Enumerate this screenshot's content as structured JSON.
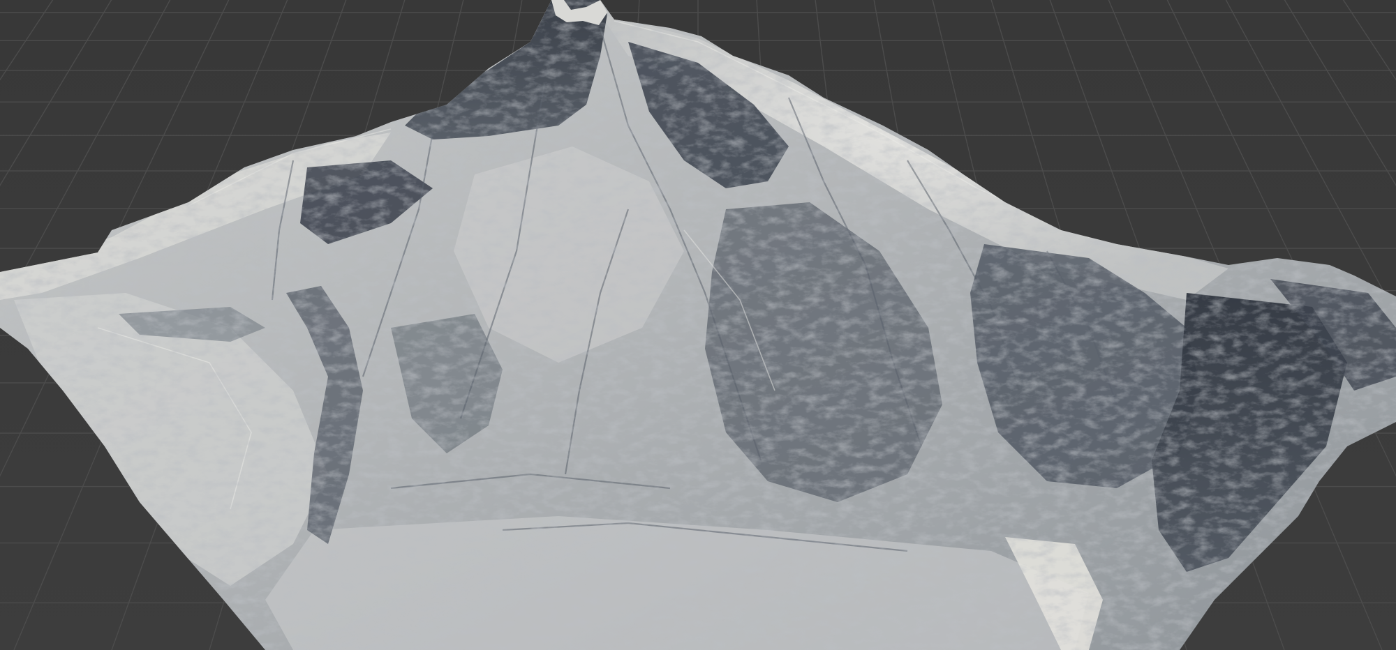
{
  "viewport": {
    "background_color": "#3b3b3b",
    "grid_color": "#4c4c4c",
    "view_mode": "perspective",
    "grid_visible": true
  },
  "terrain": {
    "object": "mountain-heightfield-mesh",
    "shading": "clay-lit",
    "base_color": "#b9bcbc",
    "highlight_color": "#e2e2df",
    "shadow_color": "#2f3540"
  }
}
